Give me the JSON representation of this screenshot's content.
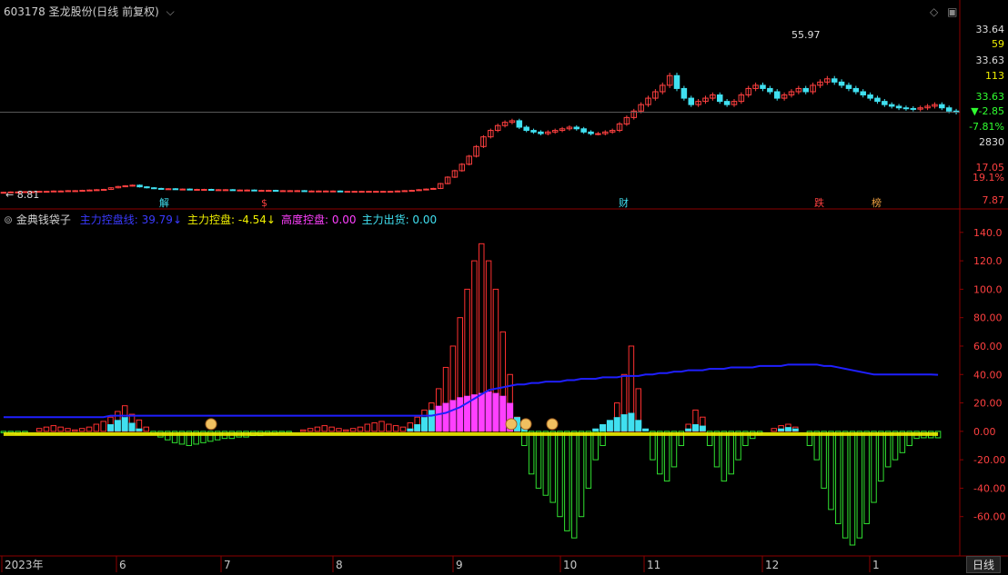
{
  "header": {
    "title": "603178 圣龙股份(日线 前复权)",
    "indicator_name": "金典钱袋子",
    "indicators": [
      {
        "label": "主力控盘线",
        "value": "39.79",
        "arrow": "↓",
        "color": "#3a3aff"
      },
      {
        "label": "主力控盘",
        "value": "-4.54",
        "arrow": "↓",
        "color": "#f0f000"
      },
      {
        "label": "高度控盘",
        "value": "0.00",
        "arrow": "",
        "color": "#ff40ff"
      },
      {
        "label": "主力出货",
        "value": "0.00",
        "arrow": "",
        "color": "#40e0f0"
      }
    ]
  },
  "price_panel": {
    "high_label": "55.97",
    "low_label": "8.81",
    "right_labels": [
      "33.64",
      "59",
      "33.63",
      "113",
      "33.63",
      "▼-2.85",
      "-7.81%",
      "2830",
      "17.05",
      "19.1%",
      "7.87"
    ],
    "markers": [
      "解",
      "$",
      "财",
      "跌",
      "榜"
    ]
  },
  "axis": {
    "months": [
      "2023年",
      "6",
      "7",
      "8",
      "9",
      "10",
      "11",
      "12",
      "1"
    ],
    "period_button": "日线"
  },
  "chart_data": [
    {
      "type": "line",
      "title": "603178 圣龙股份(日线 前复权)",
      "series": [
        {
          "name": "close",
          "values": [
            8.8,
            8.9,
            8.9,
            9.0,
            9.0,
            9.1,
            9.1,
            9.2,
            9.2,
            9.3,
            9.3,
            9.4,
            9.5,
            9.6,
            9.7,
            10.2,
            10.6,
            10.8,
            11.0,
            10.5,
            10.2,
            10.0,
            9.9,
            9.9,
            9.8,
            9.8,
            9.7,
            9.7,
            9.7,
            9.6,
            9.6,
            9.6,
            9.5,
            9.5,
            9.5,
            9.4,
            9.4,
            9.4,
            9.3,
            9.3,
            9.3,
            9.3,
            9.2,
            9.2,
            9.2,
            9.2,
            9.2,
            9.1,
            9.1,
            9.1,
            9.1,
            9.1,
            9.1,
            9.1,
            9.1,
            9.2,
            9.3,
            9.4,
            9.6,
            9.8,
            10.0,
            11.5,
            13.5,
            15.5,
            17.5,
            20.0,
            23.0,
            26.0,
            28.0,
            29.5,
            30.5,
            31.0,
            29.0,
            28.0,
            27.5,
            27.0,
            27.5,
            28.0,
            28.5,
            29.0,
            28.5,
            27.5,
            27.0,
            27.0,
            27.5,
            28.0,
            30.0,
            32.0,
            34.0,
            36.0,
            38.0,
            40.0,
            42.0,
            45.0,
            41.0,
            38.0,
            36.0,
            37.0,
            38.0,
            39.0,
            37.0,
            36.0,
            37.0,
            39.0,
            41.0,
            42.0,
            41.0,
            40.0,
            38.0,
            39.0,
            40.0,
            41.0,
            40.0,
            42.0,
            43.0,
            44.0,
            43.0,
            42.0,
            41.0,
            40.0,
            39.0,
            38.0,
            37.0,
            36.0,
            35.5,
            35.0,
            34.8,
            34.6,
            35.0,
            35.5,
            36.0,
            35.0,
            34.0,
            33.63
          ]
        }
      ],
      "annotations": [
        "55.97",
        "8.81"
      ],
      "ylim": [
        7.87,
        60
      ]
    },
    {
      "type": "bar",
      "title": "金典钱袋子",
      "series": [
        {
          "name": "主力控盘线",
          "values": [
            10,
            10,
            10,
            10,
            10,
            10,
            10,
            10,
            10,
            10,
            10,
            10,
            10,
            10,
            10,
            11,
            11,
            11,
            11,
            11,
            11,
            11,
            11,
            11,
            11,
            11,
            11,
            11,
            11,
            11,
            11,
            11,
            11,
            11,
            11,
            11,
            11,
            11,
            11,
            11,
            11,
            11,
            11,
            11,
            11,
            11,
            11,
            11,
            11,
            11,
            11,
            11,
            11,
            11,
            11,
            11,
            11,
            11,
            11,
            11,
            11,
            12,
            13,
            15,
            17,
            20,
            23,
            26,
            29,
            30,
            31,
            32,
            33,
            33,
            34,
            34,
            35,
            35,
            35,
            36,
            36,
            37,
            37,
            37,
            38,
            38,
            38,
            39,
            39,
            39,
            40,
            40,
            41,
            41,
            42,
            42,
            43,
            43,
            43,
            44,
            44,
            44,
            45,
            45,
            45,
            45,
            46,
            46,
            46,
            46,
            47,
            47,
            47,
            47,
            47,
            46,
            46,
            45,
            44,
            43,
            42,
            41,
            40,
            40,
            40,
            40,
            40,
            40,
            40,
            40,
            40,
            39.79,
            39.79,
            39.79
          ]
        },
        {
          "name": "主力控盘",
          "values": [
            -1,
            -1,
            -2,
            -1,
            0,
            2,
            3,
            4,
            3,
            2,
            1,
            2,
            3,
            5,
            7,
            10,
            14,
            18,
            12,
            8,
            3,
            -2,
            -4,
            -6,
            -8,
            -9,
            -10,
            -9,
            -8,
            -7,
            -6,
            -5,
            -5,
            -4,
            -4,
            -3,
            -3,
            -2,
            -2,
            -1,
            -1,
            0,
            1,
            2,
            3,
            4,
            3,
            2,
            1,
            2,
            3,
            5,
            6,
            7,
            5,
            4,
            3,
            6,
            10,
            15,
            20,
            30,
            45,
            60,
            80,
            100,
            120,
            132,
            120,
            100,
            70,
            40,
            10,
            -10,
            -30,
            -40,
            -45,
            -50,
            -60,
            -70,
            -75,
            -60,
            -40,
            -20,
            -10,
            5,
            20,
            40,
            60,
            30,
            0,
            -20,
            -30,
            -35,
            -25,
            -10,
            5,
            15,
            10,
            -10,
            -25,
            -35,
            -30,
            -20,
            -10,
            -5,
            -2,
            0,
            2,
            4,
            5,
            3,
            0,
            -10,
            -20,
            -40,
            -55,
            -65,
            -75,
            -80,
            -75,
            -65,
            -50,
            -35,
            -25,
            -20,
            -15,
            -10,
            -5,
            -4.54,
            -4.54,
            -4.54
          ]
        },
        {
          "name": "高度控盘",
          "values": [
            0,
            0,
            0,
            0,
            0,
            0,
            0,
            0,
            0,
            0,
            0,
            0,
            0,
            0,
            0,
            5,
            8,
            10,
            6,
            2,
            0,
            0,
            0,
            0,
            0,
            0,
            0,
            0,
            0,
            0,
            0,
            0,
            0,
            0,
            0,
            0,
            0,
            0,
            0,
            0,
            0,
            0,
            0,
            0,
            0,
            0,
            0,
            0,
            0,
            0,
            0,
            0,
            0,
            0,
            0,
            0,
            0,
            2,
            5,
            10,
            15,
            18,
            20,
            22,
            24,
            25,
            26,
            27,
            28,
            27,
            25,
            20,
            10,
            3,
            0,
            0,
            0,
            0,
            0,
            0,
            0,
            0,
            0,
            2,
            5,
            8,
            10,
            12,
            13,
            8,
            2,
            0,
            0,
            0,
            0,
            0,
            2,
            5,
            4,
            0,
            0,
            0,
            0,
            0,
            0,
            0,
            0,
            0,
            0,
            2,
            3,
            2,
            0,
            0,
            0,
            0,
            0,
            0,
            0,
            0,
            0,
            0,
            0,
            0,
            0,
            0,
            0,
            0,
            0,
            0,
            0,
            0,
            0,
            0
          ]
        },
        {
          "name": "主力出货",
          "values": [
            0,
            0,
            0,
            0,
            0,
            0,
            0,
            0,
            0,
            0,
            0,
            0,
            0,
            0,
            0,
            0,
            0,
            0,
            0,
            0,
            0,
            0,
            0,
            0,
            0,
            0,
            0,
            0,
            0,
            0,
            0,
            0,
            0,
            0,
            0,
            0,
            0,
            0,
            0,
            0,
            0,
            0,
            0,
            0,
            0,
            0,
            0,
            0,
            0,
            0,
            0,
            0,
            0,
            0,
            0,
            0,
            0,
            0,
            0,
            0,
            0,
            0,
            0,
            0,
            0,
            0,
            0,
            0,
            0,
            0,
            0,
            0,
            0,
            0,
            0,
            0,
            0,
            0,
            0,
            0,
            0,
            0,
            0,
            0,
            0,
            0,
            0,
            0,
            0,
            0,
            0,
            0,
            0,
            0,
            0,
            0,
            0,
            0,
            0,
            0,
            0,
            0,
            0,
            0,
            0,
            0,
            0,
            0,
            0,
            0,
            0,
            0,
            0,
            0,
            0,
            0,
            0,
            0,
            0,
            0,
            0,
            0,
            0,
            0,
            0,
            0,
            0,
            0,
            0,
            0,
            0,
            0,
            0,
            0
          ]
        }
      ],
      "ylim": [
        -80,
        145
      ],
      "yticks": [
        "140.0",
        "120.0",
        "100.0",
        "80.00",
        "60.00",
        "40.00",
        "20.00",
        "0.00",
        "-20.00",
        "-40.00",
        "-60.00"
      ]
    }
  ],
  "colors": {
    "up": "#ff4040",
    "down": "#40e0f0",
    "control_line": "#1f1fff",
    "control": "#f0f000",
    "high_control": "#ff40ff",
    "grid": "#8b0000",
    "axis_text": "#c8c8c8",
    "bullish_bar": "#ff3030",
    "bearish_bar": "#30e030"
  }
}
